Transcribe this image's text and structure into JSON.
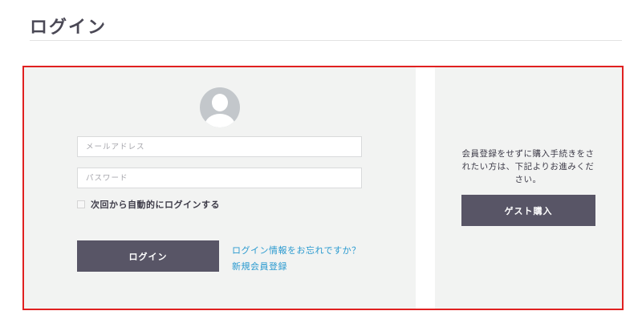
{
  "page": {
    "title": "ログイン"
  },
  "login": {
    "avatar_icon": "user-avatar-icon",
    "email_placeholder": "メールアドレス",
    "password_placeholder": "パスワード",
    "remember_label": "次回から自動的にログインする",
    "remember_checked": false,
    "submit_label": "ログイン",
    "forgot_link": "ログイン情報をお忘れですか？",
    "register_link": "新規会員登録"
  },
  "guest": {
    "description": "会員登録をせずに購入手続きをされたい方は、下記よりお進みください。",
    "button_label": "ゲスト購入"
  },
  "colors": {
    "panel_bg": "#f2f3f2",
    "button_bg": "#585566",
    "link": "#2a9ad0",
    "highlight_border": "#e02020"
  }
}
